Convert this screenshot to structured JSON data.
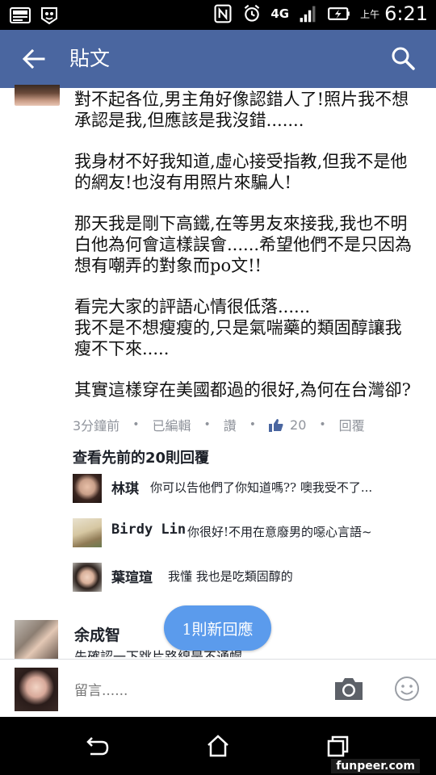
{
  "status_bar": {
    "time": "6:21",
    "ampm": "上午",
    "network": "4G",
    "icons": [
      "image-icon",
      "app-icon",
      "nfc-icon",
      "alarm-icon",
      "network-4g-icon",
      "signal-icon",
      "battery-charging-icon"
    ]
  },
  "app_bar": {
    "title": "貼文",
    "back_icon": "back-arrow-icon",
    "search_icon": "search-icon",
    "color": "#4a66a0"
  },
  "post": {
    "paragraphs": [
      "對不起各位,男主角好像認錯人了!照片我不想承認是我,但應該是我沒錯.......",
      "我身材不好我知道,虛心接受指教,但我不是他的網友!也沒有用照片來騙人!",
      "那天我是剛下高鐵,在等男友來接我,我也不明白他為何會這樣誤會......希望他們不是只因為想有嘲弄的對象而po文!!",
      "看完大家的評語心情很低落......\n我不是不想瘦瘦的,只是氣喘藥的類固醇讓我瘦不下來.....",
      "其實這樣穿在美國都過的很好,為何在台灣卻?"
    ],
    "meta": {
      "time": "3分鐘前",
      "edited": "已編輯",
      "like": "讚",
      "like_count": "20",
      "reply": "回覆"
    },
    "view_previous": "查看先前的20則回覆"
  },
  "replies": [
    {
      "name": "林琪",
      "text": "你可以告他們了你知道嗎?? 噢我受不了...",
      "avatar": "avatar-photo"
    },
    {
      "name": "Birdy Lin",
      "text": "你很好!不用在意廢男的噁心言語~",
      "avatar": "avatar-photo"
    },
    {
      "name": "葉瑄瑄",
      "text": "我懂 我也是吃類固醇的",
      "avatar": "avatar-photo"
    }
  ],
  "next_comment": {
    "name": "余成智",
    "text": "先確認一下跳片路線是不通幌"
  },
  "new_replies_pill": "1則新回應",
  "composer": {
    "placeholder": "留言......",
    "camera_icon": "camera-icon",
    "emoji_icon": "smiley-icon"
  },
  "nav_bar": {
    "icons": [
      "back-nav-icon",
      "home-nav-icon",
      "recent-apps-icon"
    ]
  },
  "watermark": "funpeer.com"
}
